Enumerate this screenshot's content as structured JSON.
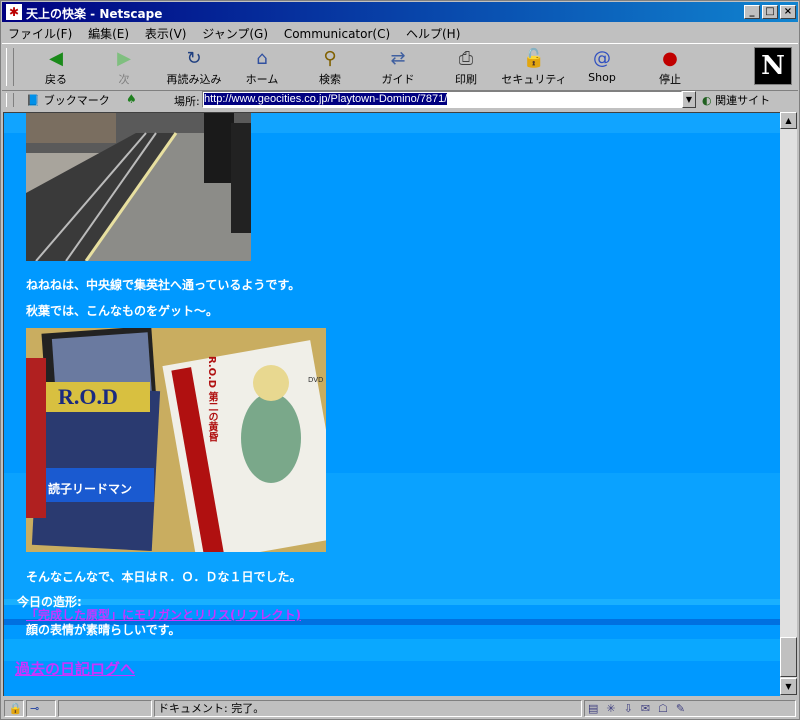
{
  "window": {
    "title": "天上の快楽 - Netscape",
    "controls": {
      "minimize": "_",
      "maximize": "□",
      "close": "×"
    }
  },
  "menu": [
    "ファイル(F)",
    "編集(E)",
    "表示(V)",
    "ジャンプ(G)",
    "Communicator(C)",
    "ヘルプ(H)"
  ],
  "toolbar": {
    "back": "戻る",
    "forward": "次",
    "reload": "再読み込み",
    "home": "ホーム",
    "search": "検索",
    "guide": "ガイド",
    "print": "印刷",
    "security": "セキュリティ",
    "shop": "Shop",
    "stop": "停止",
    "logo": "N"
  },
  "location": {
    "bookmarks": "ブックマーク",
    "label": "場所:",
    "url": "http://www.geocities.co.jp/Playtown-Domino/7871/",
    "related": "関連サイト"
  },
  "content": {
    "line1": "ねねねは、中央線で集英社へ通っているようです。",
    "line2": "秋葉では、こんなものをゲット～。",
    "line3": "そんなこんなで、本日はＲ．Ｏ．Ｄな１日でした。",
    "today_label": "今日の造形:",
    "model_link": "「完成した原型」にモリガンとリリス(リフレクト)",
    "model_note": "顔の表情が素晴らしいです。",
    "archive_link": "過去の日記ログへ",
    "photo2_texts": {
      "rod": "R.O.D",
      "band": "読子リードマン",
      "dvd_spine": "DVD",
      "dvd_title": "R.O.D 第二の黄昏"
    }
  },
  "status": {
    "text": "ドキュメント: 完了。"
  },
  "colors": {
    "page_bg": "#0099ff",
    "text": "#ffffff",
    "link": "#cc33ff"
  }
}
